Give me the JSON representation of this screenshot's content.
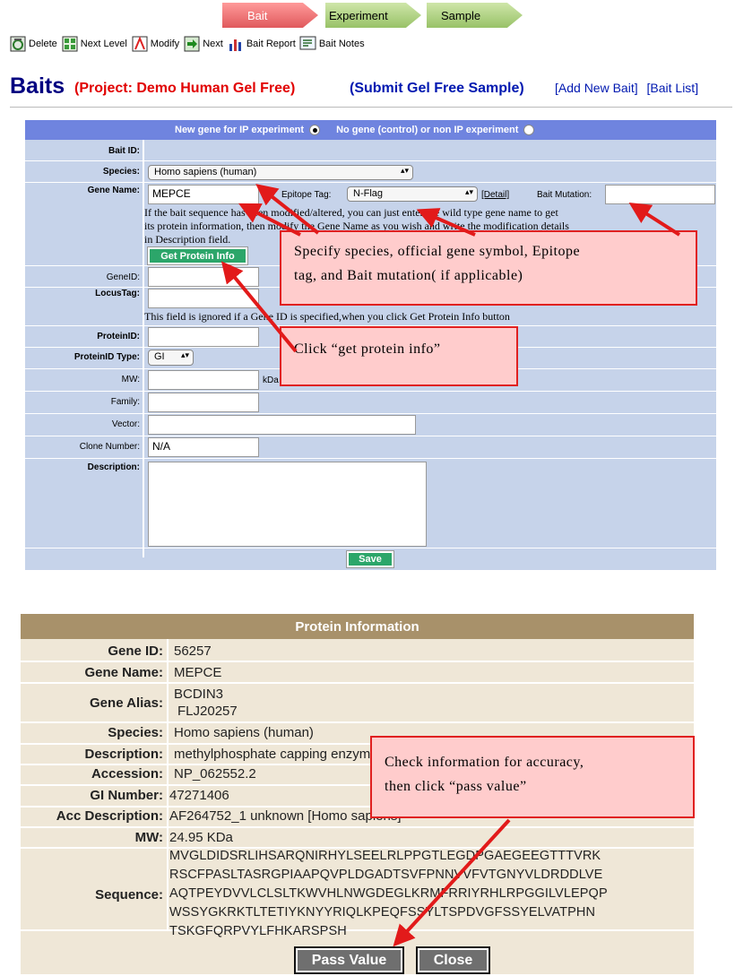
{
  "workflow": {
    "steps": [
      "Bait",
      "Experiment",
      "Sample"
    ]
  },
  "toolbar": {
    "items": [
      {
        "label": "Delete",
        "icon": "delete-icon"
      },
      {
        "label": "Next Level",
        "icon": "next-level-icon"
      },
      {
        "label": "Modify",
        "icon": "modify-icon"
      },
      {
        "label": "Next",
        "icon": "next-arrow-icon"
      },
      {
        "label": "Bait Report",
        "icon": "report-chart-icon"
      },
      {
        "label": "Bait Notes",
        "icon": "notes-icon"
      }
    ]
  },
  "header": {
    "title": "Baits",
    "project": "(Project: Demo Human Gel Free)",
    "submit": "(Submit Gel Free Sample)",
    "add_link": "[Add New Bait]",
    "list_link": "[Bait List]"
  },
  "form": {
    "option_new_gene": "New gene for IP experiment",
    "option_no_gene": "No gene (control) or non IP experiment",
    "labels": {
      "bait_id": "Bait ID:",
      "species": "Species:",
      "gene_name": "Gene Name:",
      "gene_id": "GeneID:",
      "locus_tag": "LocusTag:",
      "protein_id": "ProteinID:",
      "protein_id_type": "ProteinID Type:",
      "mw": "MW:",
      "family": "Family:",
      "vector": "Vector:",
      "clone_number": "Clone Number:",
      "description": "Description:",
      "epitope_tag": "Epitope Tag:",
      "bait_mutation": "Bait Mutation:"
    },
    "values": {
      "species": "Homo sapiens (human)",
      "gene_name": "MEPCE",
      "epitope_tag": "N-Flag",
      "protein_id_type": "GI",
      "clone_number": "N/A"
    },
    "detail_link": "[Detail]",
    "mw_unit": "kDa",
    "note_modified": [
      "If the bait sequence has been modified/altered, you can just enter the wild type gene name to get",
      "its protein information, then modify the Gene Name as you wish and write the modification details",
      "in Description field."
    ],
    "get_protein_button": "Get Protein Info",
    "note_locus": "This field is ignored if a Gene ID is specified,when you click Get Protein Info button",
    "save_button": "Save"
  },
  "callouts": {
    "specify": [
      "Specify species, official gene symbol, Epitope",
      "tag, and Bait mutation( if applicable)"
    ],
    "click_info": "Click “get protein info”",
    "check": [
      "Check information for accuracy,",
      "then click “pass value”"
    ]
  },
  "protein_info": {
    "title": "Protein Information",
    "labels": {
      "gene_id": "Gene ID:",
      "gene_name": "Gene Name:",
      "gene_alias": "Gene Alias:",
      "species": "Species:",
      "description": "Description:",
      "accession": "Accession:",
      "gi_number": "GI Number:",
      "acc_description": "Acc Description:",
      "mw": "MW:",
      "sequence": "Sequence:"
    },
    "values": {
      "gene_id": "56257",
      "gene_name": "MEPCE",
      "gene_alias": [
        "BCDIN3",
        "FLJ20257"
      ],
      "species": "Homo sapiens (human)",
      "description": "methylphosphate capping enzyme",
      "accession": "NP_062552.2",
      "gi_number": "47271406",
      "acc_description": "AF264752_1 unknown [Homo sapiens]",
      "mw": "24.95 KDa",
      "sequence": [
        "MVGLDIDSRLIHSARQNIRHYLSEELRLPPGTLEGDPGAEGEEGTTTVRK",
        "RSCFPASLTASRGPIAAPQVPLDGADTSVFPNNVVFVTGNYVLDRDDLVE",
        "AQTPEYDVVLCLSLTKWVHLNWGDEGLKRMFRRIYRHLRPGGILVLEPQP",
        "WSSYGKRKTLTETIYKNYYRIQLKPEQFSSYLTSPDVGFSSYELVATPHN",
        "TSKGFQRPVYLFHKARSPSH"
      ]
    },
    "pass_button": "Pass Value",
    "close_button": "Close"
  },
  "colors": {
    "form_bg": "#c6d3ea",
    "form_header": "#6f84df",
    "green_button": "#2ca66a",
    "protein_bg": "#efe7d7",
    "protein_header": "#a8916a",
    "callout_fill": "#ffcccc",
    "callout_border": "#e02020",
    "title_blue": "#000080",
    "project_red": "#e10000"
  }
}
